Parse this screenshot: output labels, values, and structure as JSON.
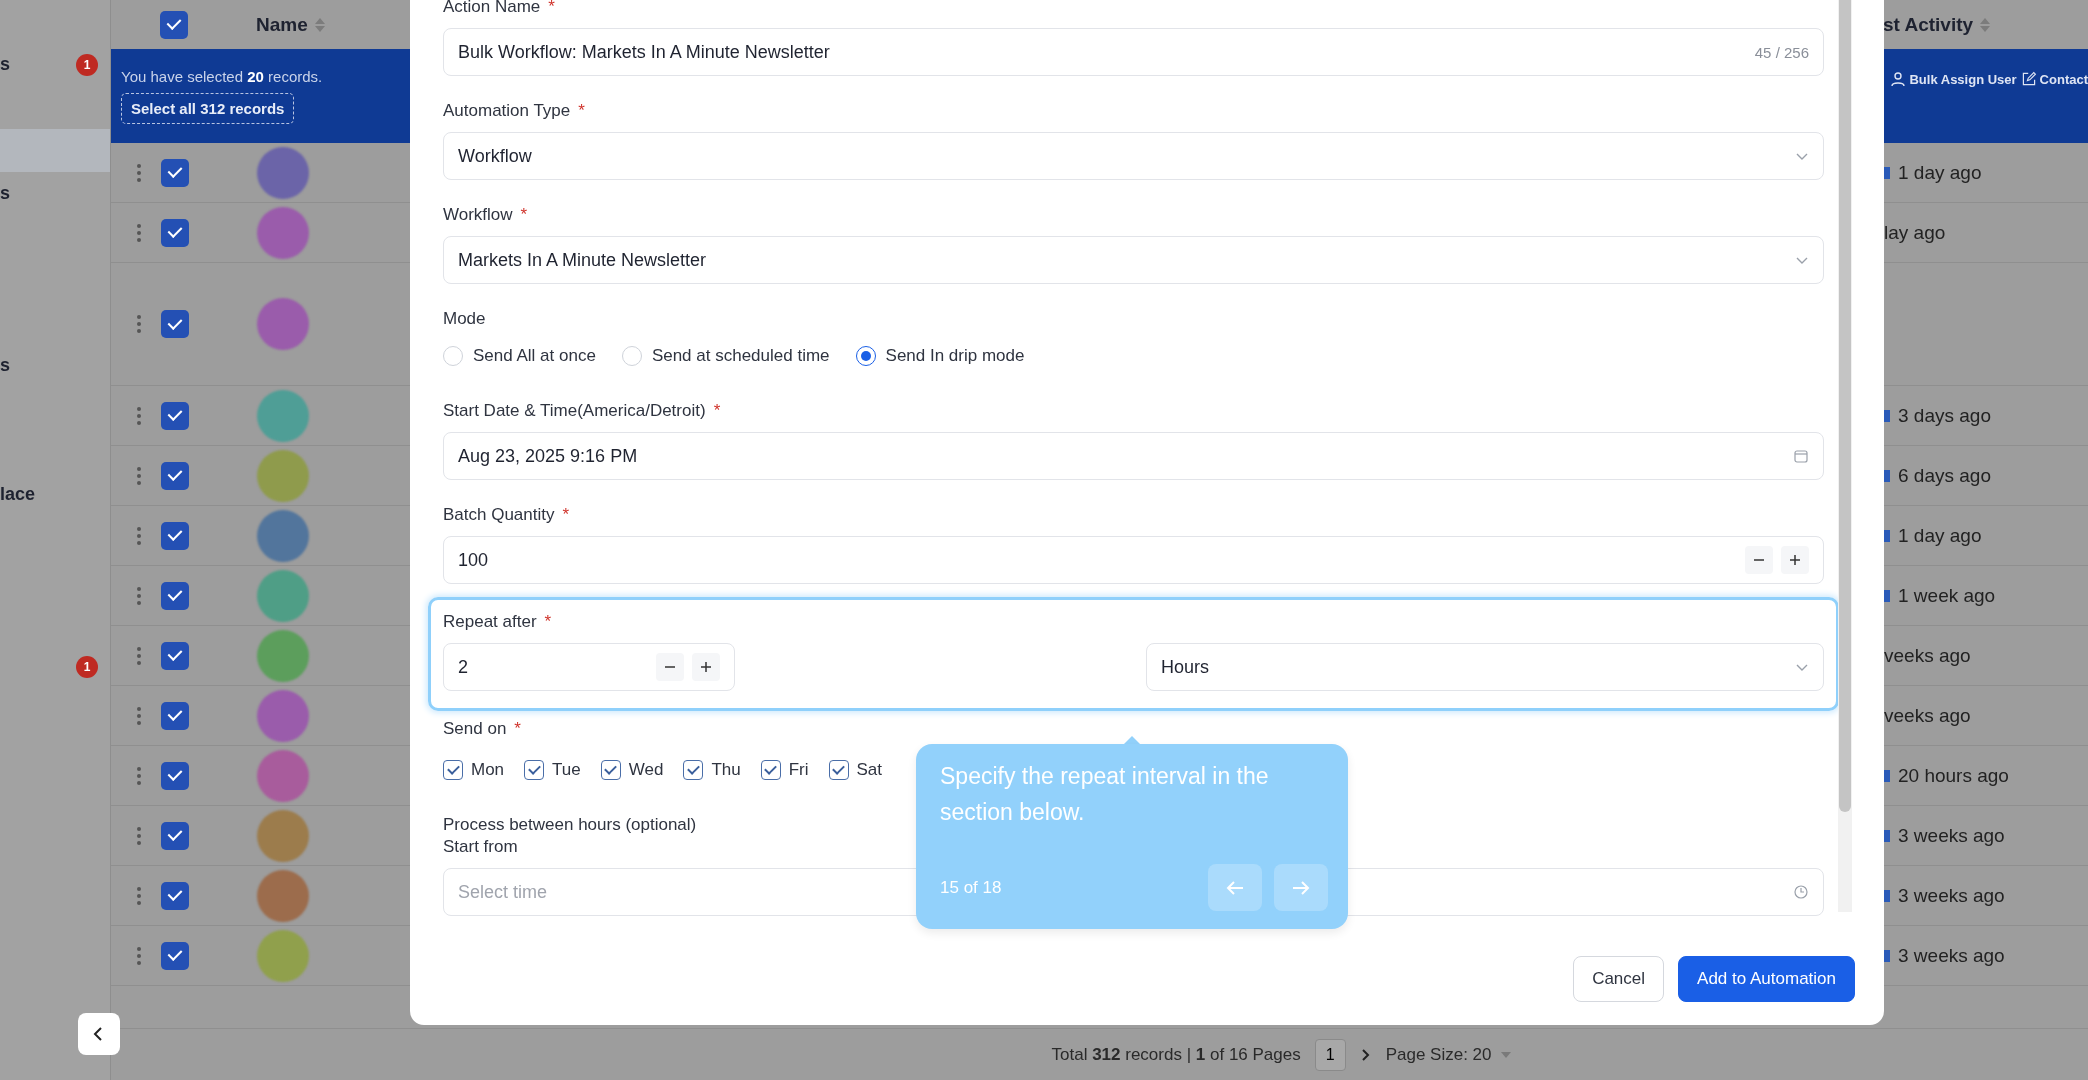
{
  "sidebar": {
    "items": [
      {
        "label": "s",
        "badge": "1",
        "selected": false
      },
      {
        "selected": true
      },
      {
        "label": "s",
        "selected": false
      },
      {
        "label": "s",
        "selected": false
      },
      {
        "label": "lace",
        "selected": false
      },
      {
        "badge": "1",
        "selected": false
      }
    ]
  },
  "table": {
    "header": {
      "checked": true,
      "name": "Name",
      "last_activity": "st Activity"
    },
    "selection_bar": {
      "message": "You have selected **20** records.",
      "select_all": "Select all 312 records",
      "actions": [
        {
          "label": "Bulk Assign User",
          "kind": "user"
        },
        {
          "label": "Contact",
          "kind": "edit"
        }
      ]
    },
    "rows": [
      {
        "checked": true,
        "color": "#6b64a8",
        "icon": true,
        "last_activity": "1 day ago"
      },
      {
        "checked": true,
        "color": "#9a5cab",
        "icon": false,
        "last_activity": "lay ago"
      },
      {
        "checked": true,
        "color": "#9a5cab",
        "icon": false
      },
      {
        "checked": true,
        "color": "#4f9e96",
        "icon": true,
        "last_activity": "3 days ago"
      },
      {
        "checked": true,
        "color": "#8f9b4c",
        "icon": true,
        "last_activity": "6 days ago"
      },
      {
        "checked": true,
        "color": "#52759c",
        "icon": true,
        "last_activity": "1 day ago"
      },
      {
        "checked": true,
        "color": "#4f9e86",
        "icon": true,
        "last_activity": "1 week ago"
      },
      {
        "checked": true,
        "color": "#5c9e5c",
        "icon": false,
        "last_activity": "veeks ago"
      },
      {
        "checked": true,
        "color": "#9a5cab",
        "icon": false,
        "last_activity": "veeks ago"
      },
      {
        "checked": true,
        "color": "#a85c9c",
        "icon": true,
        "last_activity": "20 hours ago"
      },
      {
        "checked": true,
        "color": "#9c7c4c",
        "icon": true,
        "last_activity": "3 weeks ago"
      },
      {
        "checked": true,
        "color": "#9c6c4c",
        "icon": true,
        "last_activity": "3 weeks ago"
      },
      {
        "checked": true,
        "color": "#90a04c",
        "icon": true,
        "last_activity": "3 weeks ago"
      }
    ]
  },
  "pagination": {
    "summary": "Total **312** records | **1** of 16 Pages",
    "page": "1",
    "page_size": "Page Size: 20"
  },
  "modal": {
    "action_name": {
      "label": "Action Name",
      "required_mark": "*",
      "value": "Bulk Workflow: Markets In A Minute Newsletter",
      "counter": "45 / 256"
    },
    "automation_type": {
      "label": "Automation Type",
      "required_mark": "*",
      "value": "Workflow"
    },
    "workflow": {
      "label": "Workflow",
      "required_mark": "*",
      "value": "Markets In A Minute Newsletter"
    },
    "mode": {
      "label": "Mode",
      "options": [
        {
          "label": "Send All at once",
          "selected": false
        },
        {
          "label": "Send at scheduled time",
          "selected": false
        },
        {
          "label": "Send In drip mode",
          "selected": true
        }
      ]
    },
    "start_date": {
      "label": "Start Date & Time(America/Detroit)",
      "required_mark": "*",
      "value": "Aug 23, 2025 9:16 PM"
    },
    "batch_quantity": {
      "label": "Batch Quantity",
      "required_mark": "*",
      "value": "100"
    },
    "repeat_after": {
      "label": "Repeat after",
      "required_mark": "*",
      "value": "2",
      "unit": "Hours",
      "highlighted": true
    },
    "send_on": {
      "label": "Send on",
      "required_mark": "*",
      "days": [
        {
          "label": "Mon",
          "checked": true
        },
        {
          "label": "Tue",
          "checked": true
        },
        {
          "label": "Wed",
          "checked": true
        },
        {
          "label": "Thu",
          "checked": true
        },
        {
          "label": "Fri",
          "checked": true
        },
        {
          "label": "Sat",
          "checked": true
        }
      ]
    },
    "process_hours": {
      "label": "Process between hours (optional)",
      "sublabel": "Start from",
      "placeholder": "Select time"
    },
    "buttons": [
      {
        "label": "Cancel",
        "kind": "secondary"
      },
      {
        "label": "Add to Automation",
        "kind": "primary"
      }
    ]
  },
  "tooltip": {
    "text": "Specify the repeat interval in the section below.",
    "progress": "15 of 18"
  }
}
